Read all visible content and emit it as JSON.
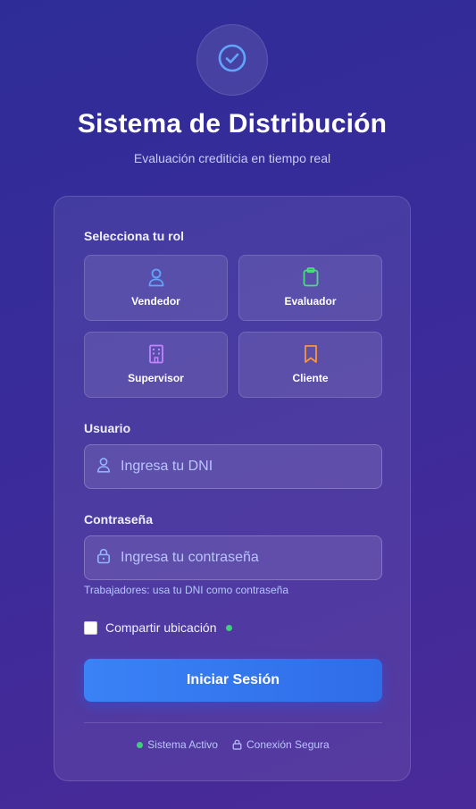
{
  "header": {
    "title": "Sistema de Distribución",
    "subtitle": "Evaluación crediticia en tiempo real",
    "logo_icon": "check-circle-icon"
  },
  "roles": {
    "label": "Selecciona tu rol",
    "items": [
      {
        "label": "Vendedor",
        "icon": "user-icon",
        "color": "#60a5fa"
      },
      {
        "label": "Evaluador",
        "icon": "clipboard-icon",
        "color": "#4ade80"
      },
      {
        "label": "Supervisor",
        "icon": "building-icon",
        "color": "#c084fc"
      },
      {
        "label": "Cliente",
        "icon": "bookmark-icon",
        "color": "#fb923c"
      }
    ]
  },
  "username": {
    "label": "Usuario",
    "placeholder": "Ingresa tu DNI",
    "value": ""
  },
  "password": {
    "label": "Contraseña",
    "placeholder": "Ingresa tu contraseña",
    "value": "",
    "hint": "Trabajadores: usa tu DNI como contraseña"
  },
  "location": {
    "label": "Compartir ubicación",
    "checked": false
  },
  "submit": {
    "label": "Iniciar Sesión"
  },
  "status": {
    "active": "Sistema Activo",
    "secure": "Conexión Segura"
  },
  "colors": {
    "accent": "#3b82f6",
    "success": "#3ecf7d"
  }
}
